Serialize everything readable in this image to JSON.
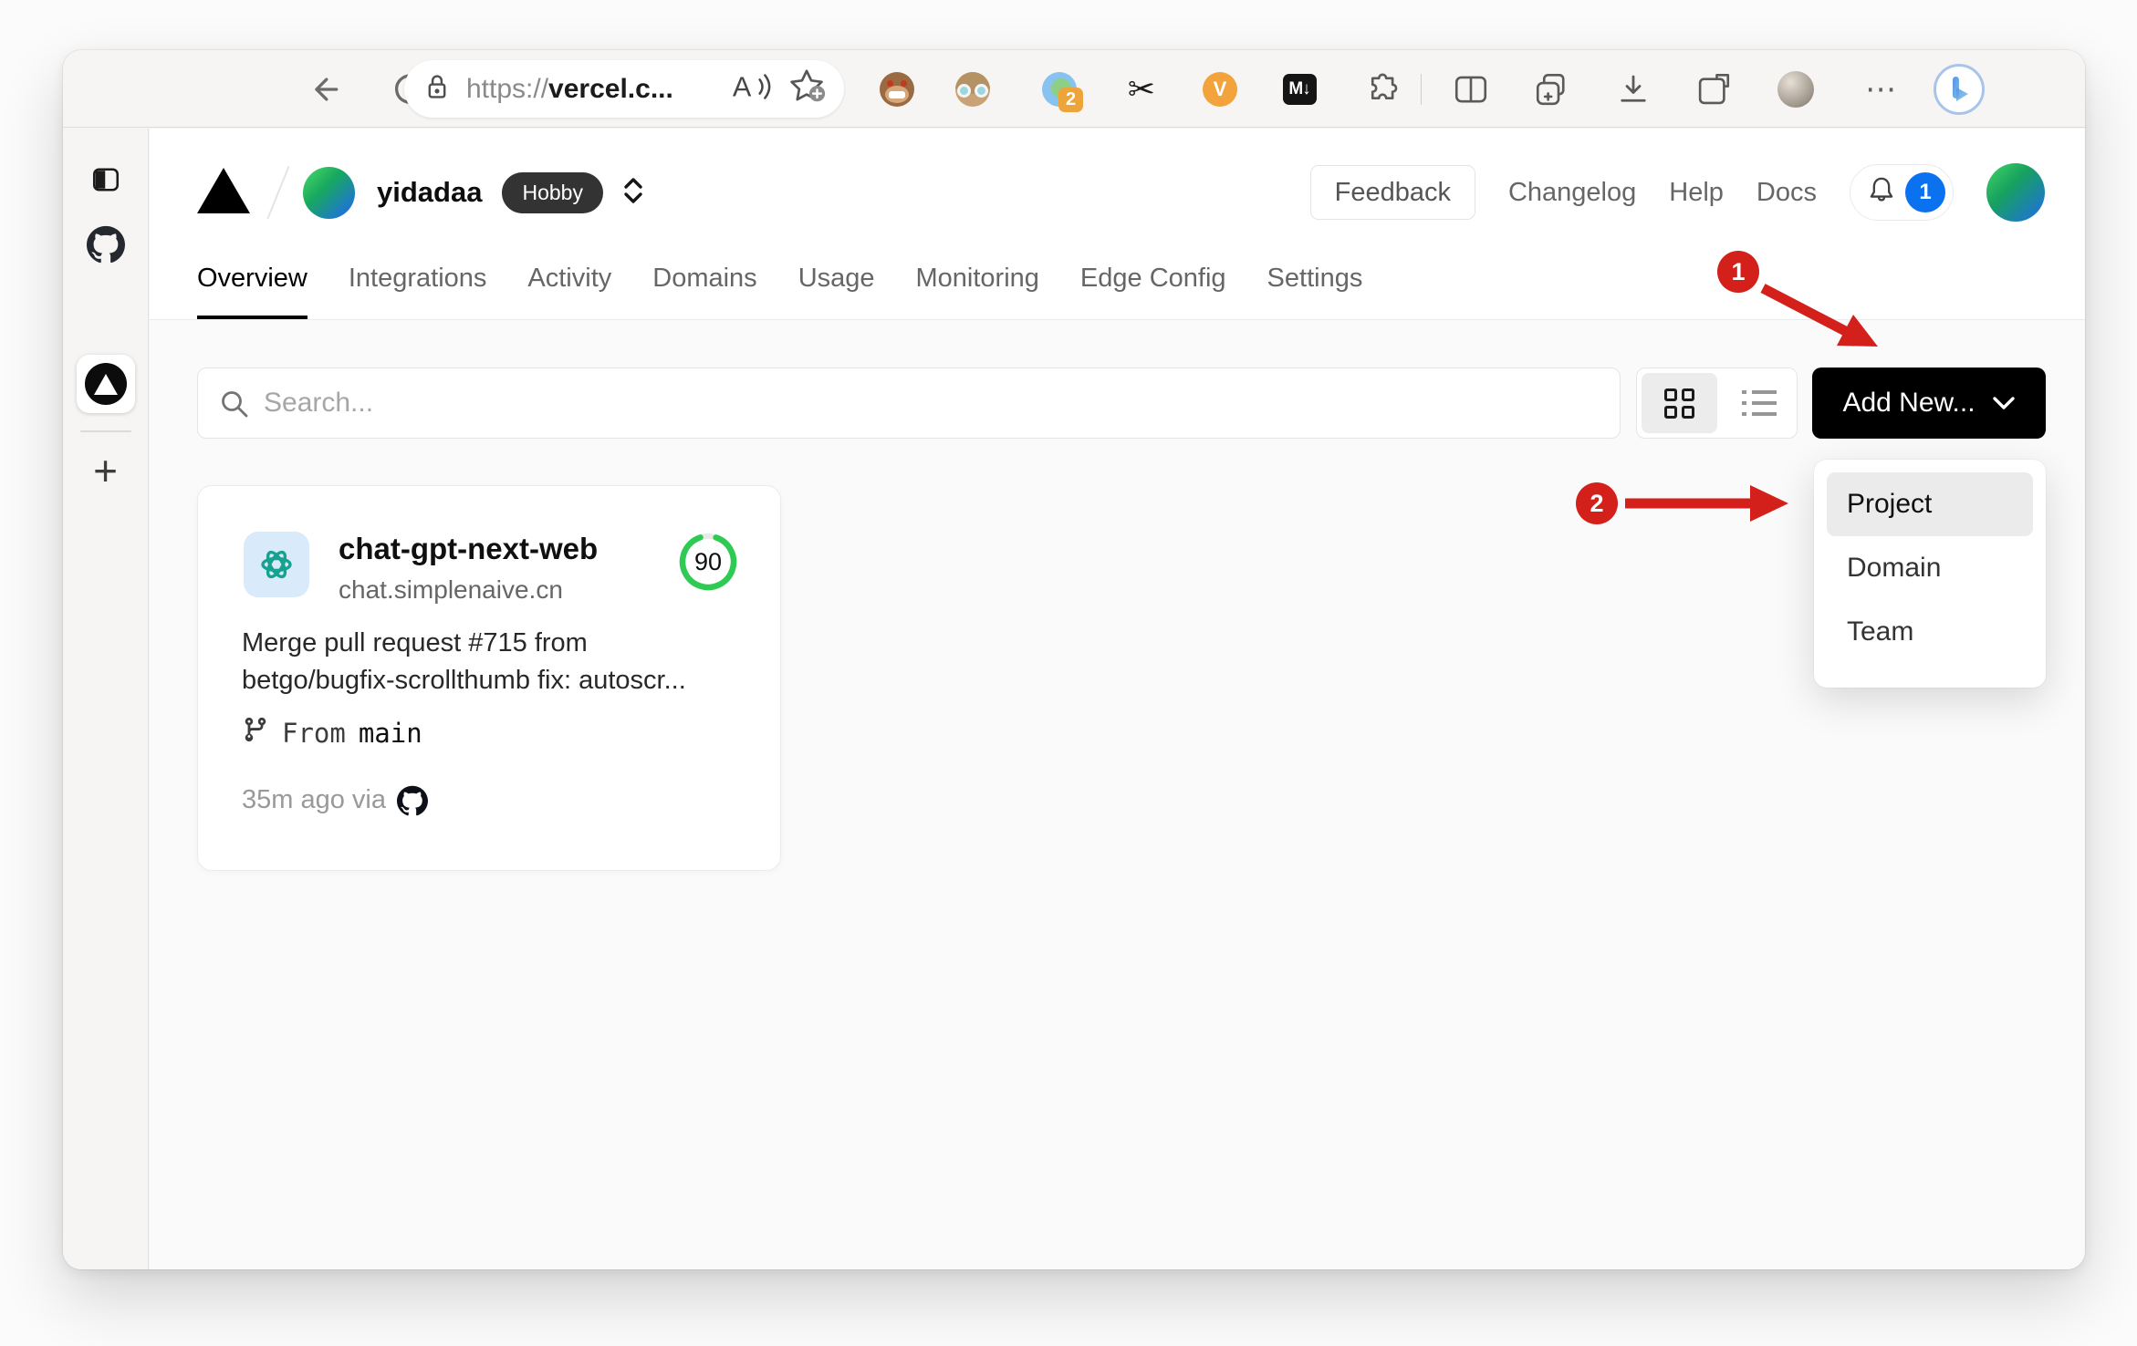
{
  "browser_toolbar": {
    "url_scheme": "https://",
    "url_host": "vercel.c...",
    "read_aloud_label": "A",
    "scissors_glyph": "✂",
    "extension_badge_count": "2",
    "v_icon_label": "V",
    "markdown_icon_label": "M↓",
    "more_label": "⋯"
  },
  "browser_sidebar": {
    "new_tab_label": "+"
  },
  "header": {
    "team_name": "yidadaa",
    "plan_badge": "Hobby",
    "feedback_label": "Feedback",
    "nav_links": [
      "Changelog",
      "Help",
      "Docs"
    ],
    "notification_count": "1"
  },
  "tabs": [
    {
      "label": "Overview",
      "active": true
    },
    {
      "label": "Integrations"
    },
    {
      "label": "Activity"
    },
    {
      "label": "Domains"
    },
    {
      "label": "Usage"
    },
    {
      "label": "Monitoring"
    },
    {
      "label": "Edge Config"
    },
    {
      "label": "Settings"
    }
  ],
  "controls": {
    "search_placeholder": "Search...",
    "add_new_label": "Add New..."
  },
  "add_new_menu": {
    "items": [
      "Project",
      "Domain",
      "Team"
    ],
    "highlighted": "Project"
  },
  "project_card": {
    "name": "chat-gpt-next-web",
    "domain": "chat.simplenaive.cn",
    "score": "90",
    "commit_line1": "Merge pull request #715 from",
    "commit_line2": "betgo/bugfix-scrollthumb fix: autoscr...",
    "branch_prefix": "From",
    "branch_name": "main",
    "deployed_text": "35m ago via"
  },
  "annotations": {
    "step1": "1",
    "step2": "2"
  },
  "colors": {
    "annotation_red": "#d3201a",
    "ring_green": "#2fca53",
    "badge_blue": "#0b72ef",
    "accent_black": "#000000"
  }
}
